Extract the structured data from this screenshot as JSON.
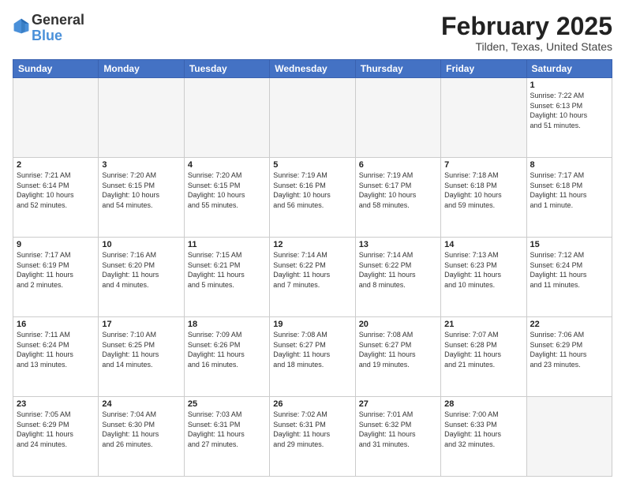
{
  "header": {
    "logo_general": "General",
    "logo_blue": "Blue",
    "month_title": "February 2025",
    "location": "Tilden, Texas, United States"
  },
  "days_of_week": [
    "Sunday",
    "Monday",
    "Tuesday",
    "Wednesday",
    "Thursday",
    "Friday",
    "Saturday"
  ],
  "weeks": [
    [
      {
        "day": "",
        "info": ""
      },
      {
        "day": "",
        "info": ""
      },
      {
        "day": "",
        "info": ""
      },
      {
        "day": "",
        "info": ""
      },
      {
        "day": "",
        "info": ""
      },
      {
        "day": "",
        "info": ""
      },
      {
        "day": "1",
        "info": "Sunrise: 7:22 AM\nSunset: 6:13 PM\nDaylight: 10 hours\nand 51 minutes."
      }
    ],
    [
      {
        "day": "2",
        "info": "Sunrise: 7:21 AM\nSunset: 6:14 PM\nDaylight: 10 hours\nand 52 minutes."
      },
      {
        "day": "3",
        "info": "Sunrise: 7:20 AM\nSunset: 6:15 PM\nDaylight: 10 hours\nand 54 minutes."
      },
      {
        "day": "4",
        "info": "Sunrise: 7:20 AM\nSunset: 6:15 PM\nDaylight: 10 hours\nand 55 minutes."
      },
      {
        "day": "5",
        "info": "Sunrise: 7:19 AM\nSunset: 6:16 PM\nDaylight: 10 hours\nand 56 minutes."
      },
      {
        "day": "6",
        "info": "Sunrise: 7:19 AM\nSunset: 6:17 PM\nDaylight: 10 hours\nand 58 minutes."
      },
      {
        "day": "7",
        "info": "Sunrise: 7:18 AM\nSunset: 6:18 PM\nDaylight: 10 hours\nand 59 minutes."
      },
      {
        "day": "8",
        "info": "Sunrise: 7:17 AM\nSunset: 6:18 PM\nDaylight: 11 hours\nand 1 minute."
      }
    ],
    [
      {
        "day": "9",
        "info": "Sunrise: 7:17 AM\nSunset: 6:19 PM\nDaylight: 11 hours\nand 2 minutes."
      },
      {
        "day": "10",
        "info": "Sunrise: 7:16 AM\nSunset: 6:20 PM\nDaylight: 11 hours\nand 4 minutes."
      },
      {
        "day": "11",
        "info": "Sunrise: 7:15 AM\nSunset: 6:21 PM\nDaylight: 11 hours\nand 5 minutes."
      },
      {
        "day": "12",
        "info": "Sunrise: 7:14 AM\nSunset: 6:22 PM\nDaylight: 11 hours\nand 7 minutes."
      },
      {
        "day": "13",
        "info": "Sunrise: 7:14 AM\nSunset: 6:22 PM\nDaylight: 11 hours\nand 8 minutes."
      },
      {
        "day": "14",
        "info": "Sunrise: 7:13 AM\nSunset: 6:23 PM\nDaylight: 11 hours\nand 10 minutes."
      },
      {
        "day": "15",
        "info": "Sunrise: 7:12 AM\nSunset: 6:24 PM\nDaylight: 11 hours\nand 11 minutes."
      }
    ],
    [
      {
        "day": "16",
        "info": "Sunrise: 7:11 AM\nSunset: 6:24 PM\nDaylight: 11 hours\nand 13 minutes."
      },
      {
        "day": "17",
        "info": "Sunrise: 7:10 AM\nSunset: 6:25 PM\nDaylight: 11 hours\nand 14 minutes."
      },
      {
        "day": "18",
        "info": "Sunrise: 7:09 AM\nSunset: 6:26 PM\nDaylight: 11 hours\nand 16 minutes."
      },
      {
        "day": "19",
        "info": "Sunrise: 7:08 AM\nSunset: 6:27 PM\nDaylight: 11 hours\nand 18 minutes."
      },
      {
        "day": "20",
        "info": "Sunrise: 7:08 AM\nSunset: 6:27 PM\nDaylight: 11 hours\nand 19 minutes."
      },
      {
        "day": "21",
        "info": "Sunrise: 7:07 AM\nSunset: 6:28 PM\nDaylight: 11 hours\nand 21 minutes."
      },
      {
        "day": "22",
        "info": "Sunrise: 7:06 AM\nSunset: 6:29 PM\nDaylight: 11 hours\nand 23 minutes."
      }
    ],
    [
      {
        "day": "23",
        "info": "Sunrise: 7:05 AM\nSunset: 6:29 PM\nDaylight: 11 hours\nand 24 minutes."
      },
      {
        "day": "24",
        "info": "Sunrise: 7:04 AM\nSunset: 6:30 PM\nDaylight: 11 hours\nand 26 minutes."
      },
      {
        "day": "25",
        "info": "Sunrise: 7:03 AM\nSunset: 6:31 PM\nDaylight: 11 hours\nand 27 minutes."
      },
      {
        "day": "26",
        "info": "Sunrise: 7:02 AM\nSunset: 6:31 PM\nDaylight: 11 hours\nand 29 minutes."
      },
      {
        "day": "27",
        "info": "Sunrise: 7:01 AM\nSunset: 6:32 PM\nDaylight: 11 hours\nand 31 minutes."
      },
      {
        "day": "28",
        "info": "Sunrise: 7:00 AM\nSunset: 6:33 PM\nDaylight: 11 hours\nand 32 minutes."
      },
      {
        "day": "",
        "info": ""
      }
    ]
  ]
}
